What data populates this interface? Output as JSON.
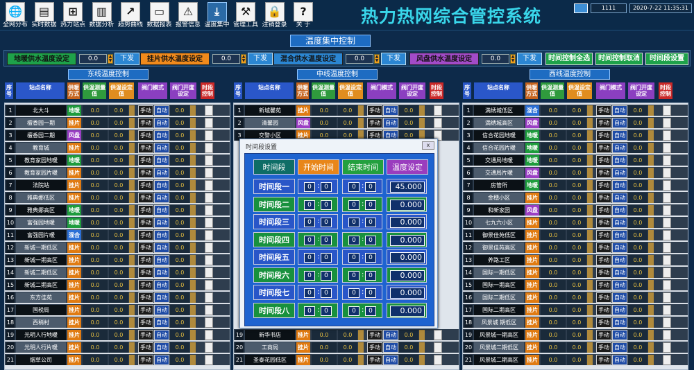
{
  "app": {
    "title": "热力热网综合管控系统",
    "user": "1111",
    "datetime": "2020-7-22 11:35:31"
  },
  "toolbar": [
    {
      "label": "全网分布",
      "icon": "globe-icon",
      "glyph": "🌐"
    },
    {
      "label": "实时数据",
      "icon": "document-icon",
      "glyph": "▤"
    },
    {
      "label": "热力站点",
      "icon": "network-icon",
      "glyph": "⊞"
    },
    {
      "label": "数据分析",
      "icon": "bar-chart-icon",
      "glyph": "▥"
    },
    {
      "label": "趋势曲线",
      "icon": "line-chart-icon",
      "glyph": "↗"
    },
    {
      "label": "数据报表",
      "icon": "folder-icon",
      "glyph": "▭"
    },
    {
      "label": "报警信息",
      "icon": "warning-icon",
      "glyph": "⚠"
    },
    {
      "label": "温度集中",
      "icon": "download-icon",
      "glyph": "⤓"
    },
    {
      "label": "管理工具",
      "icon": "tools-icon",
      "glyph": "⚒"
    },
    {
      "label": "注销登录",
      "icon": "lock-icon",
      "glyph": "🔒"
    },
    {
      "label": "关 于",
      "icon": "help-icon",
      "glyph": "?"
    }
  ],
  "main_title": "温度集中控制",
  "control": {
    "groups": [
      {
        "label": "地暖供水温度设定",
        "value": "0.0",
        "button": "下发",
        "color": "#1ea24a"
      },
      {
        "label": "挂片供水温度设定",
        "value": "0.0",
        "button": "下发",
        "color": "#f08a1c"
      },
      {
        "label": "混合供水温度设定",
        "value": "0.0",
        "button": "下发",
        "color": "#2b86d2"
      },
      {
        "label": "风盘供水温度设定",
        "value": "0.0",
        "button": "下发",
        "color": "#a24bc8"
      }
    ],
    "time_all": "时间控制全选",
    "time_cancel": "时间控制取消",
    "time_setting": "时间段设置"
  },
  "sections": [
    {
      "title": "东线温度控制"
    },
    {
      "title": "中线温度控制"
    },
    {
      "title": "西线温度控制"
    }
  ],
  "headers": {
    "no": "序号",
    "name": "站点名称",
    "type": "供暖方式",
    "measured": "供温测量值",
    "setvalue": "供温设定值",
    "mode": "阀门模式",
    "valve_set": "阀门开度设定",
    "time_ctrl": "时段控制"
  },
  "row_labels": {
    "measured_val": "0.0",
    "set_val": "0.0",
    "manual": "手动",
    "auto": "自动"
  },
  "east": [
    {
      "no": "1",
      "name": "北大斗",
      "type": "地暖"
    },
    {
      "no": "2",
      "name": "檀香园一期",
      "type": "挂片"
    },
    {
      "no": "3",
      "name": "檀香园二期",
      "type": "风盘"
    },
    {
      "no": "4",
      "name": "教育城",
      "type": "挂片"
    },
    {
      "no": "5",
      "name": "教育家园地暖",
      "type": "地暖"
    },
    {
      "no": "6",
      "name": "教育家园片暖",
      "type": "挂片"
    },
    {
      "no": "7",
      "name": "法院站",
      "type": "挂片"
    },
    {
      "no": "8",
      "name": "雅典娜低区",
      "type": "挂片"
    },
    {
      "no": "9",
      "name": "雅典娜高区",
      "type": "地暖"
    },
    {
      "no": "10",
      "name": "富强园地暖",
      "type": "地暖"
    },
    {
      "no": "11",
      "name": "富强园片暖",
      "type": "混合"
    },
    {
      "no": "12",
      "name": "新城一期低区",
      "type": "挂片"
    },
    {
      "no": "13",
      "name": "新城一期高区",
      "type": "挂片"
    },
    {
      "no": "14",
      "name": "新城二期低区",
      "type": "挂片"
    },
    {
      "no": "15",
      "name": "新城二期高区",
      "type": "挂片"
    },
    {
      "no": "16",
      "name": "东方佳苑",
      "type": "挂片"
    },
    {
      "no": "17",
      "name": "国税局",
      "type": "挂片"
    },
    {
      "no": "18",
      "name": "西稍村",
      "type": "挂片"
    },
    {
      "no": "19",
      "name": "光明人行地暖",
      "type": "挂片"
    },
    {
      "no": "20",
      "name": "光明人行片暖",
      "type": "挂片"
    },
    {
      "no": "21",
      "name": "烟草公司",
      "type": "挂片"
    }
  ],
  "middle": [
    {
      "no": "1",
      "name": "新城馨苑",
      "type": "挂片"
    },
    {
      "no": "2",
      "name": "清馨园",
      "type": "风盘"
    },
    {
      "no": "3",
      "name": "交警小区",
      "type": "挂片"
    },
    {
      "no": "19",
      "name": "新华书店",
      "type": "挂片"
    },
    {
      "no": "20",
      "name": "工商局",
      "type": "挂片"
    },
    {
      "no": "21",
      "name": "圣泰花园低区",
      "type": "挂片"
    }
  ],
  "west": [
    {
      "no": "1",
      "name": "満绣城低区",
      "type": "混合"
    },
    {
      "no": "2",
      "name": "満绣城高区",
      "type": "风盘"
    },
    {
      "no": "3",
      "name": "信合花园地暖",
      "type": "地暖"
    },
    {
      "no": "4",
      "name": "信合花园片暖",
      "type": "地暖"
    },
    {
      "no": "5",
      "name": "交通局地暖",
      "type": "地暖"
    },
    {
      "no": "6",
      "name": "交通局片暖",
      "type": "风盘"
    },
    {
      "no": "7",
      "name": "房管所",
      "type": "地暖"
    },
    {
      "no": "8",
      "name": "金穗小区",
      "type": "挂片"
    },
    {
      "no": "9",
      "name": "和新家园",
      "type": "风盘"
    },
    {
      "no": "10",
      "name": "七九六小区",
      "type": "挂片"
    },
    {
      "no": "11",
      "name": "御景佳苑低区",
      "type": "挂片"
    },
    {
      "no": "12",
      "name": "御景佳苑高区",
      "type": "挂片"
    },
    {
      "no": "13",
      "name": "养路工区",
      "type": "挂片"
    },
    {
      "no": "14",
      "name": "国际一期低区",
      "type": "挂片"
    },
    {
      "no": "15",
      "name": "国际一期高区",
      "type": "挂片"
    },
    {
      "no": "16",
      "name": "国际二期低区",
      "type": "挂片"
    },
    {
      "no": "17",
      "name": "国际二期高区",
      "type": "挂片"
    },
    {
      "no": "18",
      "name": "风景城 期低区",
      "type": "挂片"
    },
    {
      "no": "19",
      "name": "风景城一期高区",
      "type": "挂片"
    },
    {
      "no": "20",
      "name": "风景城二期低区",
      "type": "挂片"
    },
    {
      "no": "21",
      "name": "风景城二期高区",
      "type": "挂片"
    }
  ],
  "dialog": {
    "title": "时间段设置",
    "close": "x",
    "headers": [
      "时间段",
      "开始时间",
      "结束时间",
      "温度设定"
    ],
    "periods": [
      {
        "label": "时间段一",
        "start_h": "0",
        "start_m": "0",
        "end_h": "0",
        "end_m": "0",
        "temp": "45.000"
      },
      {
        "label": "时间段二",
        "start_h": "0",
        "start_m": "0",
        "end_h": "0",
        "end_m": "0",
        "temp": "0.000"
      },
      {
        "label": "时间段三",
        "start_h": "0",
        "start_m": "0",
        "end_h": "0",
        "end_m": "0",
        "temp": "0.000"
      },
      {
        "label": "时间段四",
        "start_h": "0",
        "start_m": "0",
        "end_h": "0",
        "end_m": "0",
        "temp": "0.000"
      },
      {
        "label": "时间段五",
        "start_h": "0",
        "start_m": "0",
        "end_h": "0",
        "end_m": "0",
        "temp": "0.000"
      },
      {
        "label": "时间段六",
        "start_h": "0",
        "start_m": "0",
        "end_h": "0",
        "end_m": "0",
        "temp": "0.000"
      },
      {
        "label": "时间段七",
        "start_h": "0",
        "start_m": "0",
        "end_h": "0",
        "end_m": "0",
        "temp": "0.000"
      },
      {
        "label": "时间段八",
        "start_h": "0",
        "start_m": "0",
        "end_h": "0",
        "end_m": "0",
        "temp": "0.000"
      }
    ]
  }
}
